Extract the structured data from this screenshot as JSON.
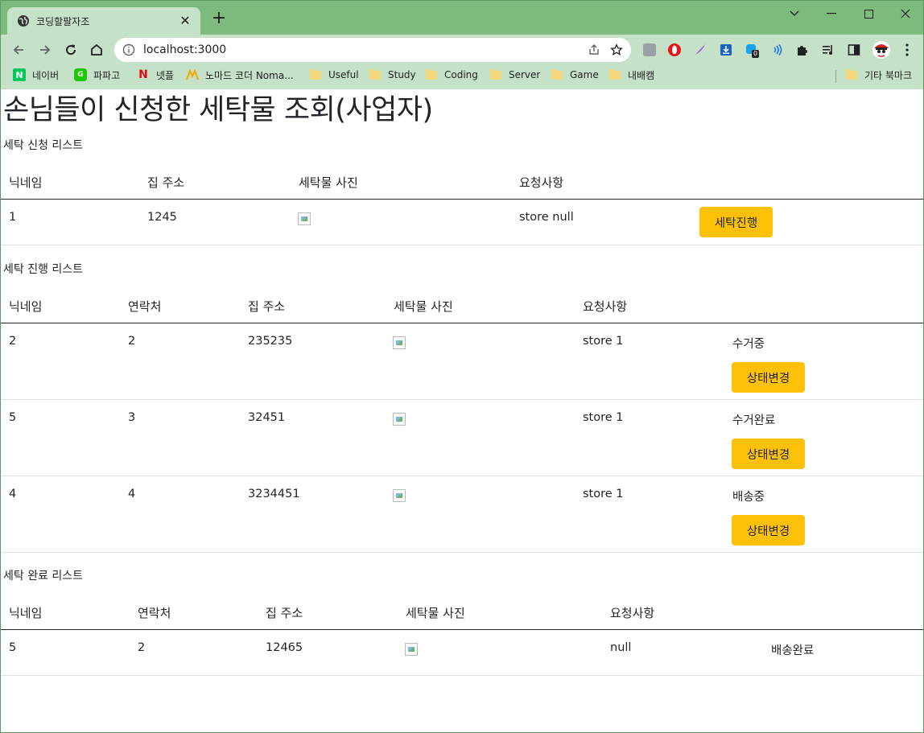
{
  "browser": {
    "tab_title": "코딩할팔자조",
    "url": "localhost:3000",
    "bookmarks": [
      {
        "label": "네이버",
        "icon": "naver-icon"
      },
      {
        "label": "파파고",
        "icon": "papago-icon"
      },
      {
        "label": "넷플",
        "icon": "netflix-icon"
      },
      {
        "label": "노마드 코더 Noma...",
        "icon": "nomad-icon"
      },
      {
        "label": "Useful",
        "icon": "folder-icon"
      },
      {
        "label": "Study",
        "icon": "folder-icon"
      },
      {
        "label": "Coding",
        "icon": "folder-icon"
      },
      {
        "label": "Server",
        "icon": "folder-icon"
      },
      {
        "label": "Game",
        "icon": "folder-icon"
      },
      {
        "label": "내배캠",
        "icon": "folder-icon"
      }
    ],
    "other_bookmarks": "기타 북마크",
    "extension_badge": "0"
  },
  "page": {
    "title": "손님들이 신청한 세탁물 조회(사업자)",
    "requests": {
      "title": "세탁 신청 리스트",
      "headers": [
        "닉네임",
        "집 주소",
        "세탁물 사진",
        "요청사항"
      ],
      "rows": [
        {
          "nickname": "1",
          "address": "1245",
          "request": "store null",
          "button": "세탁진행"
        }
      ]
    },
    "in_progress": {
      "title": "세탁 진행 리스트",
      "headers": [
        "닉네임",
        "연락처",
        "집 주소",
        "세탁물 사진",
        "요청사항"
      ],
      "rows": [
        {
          "nickname": "2",
          "phone": "2",
          "address": "235235",
          "request": "store 1",
          "status": "수거중",
          "button": "상태변경"
        },
        {
          "nickname": "5",
          "phone": "3",
          "address": "32451",
          "request": "store 1",
          "status": "수거완료",
          "button": "상태변경"
        },
        {
          "nickname": "4",
          "phone": "4",
          "address": "3234451",
          "request": "store 1",
          "status": "배송중",
          "button": "상태변경"
        }
      ]
    },
    "completed": {
      "title": "세탁 완료 리스트",
      "headers": [
        "닉네임",
        "연락처",
        "집 주소",
        "세탁물 사진",
        "요청사항"
      ],
      "rows": [
        {
          "nickname": "5",
          "phone": "2",
          "address": "12465",
          "request": "null",
          "status": "배송완료"
        }
      ]
    }
  },
  "colors": {
    "accent_button": "#ffc107",
    "chrome_tabstrip": "#7dba7e",
    "chrome_toolbar": "#c5e2c8"
  }
}
